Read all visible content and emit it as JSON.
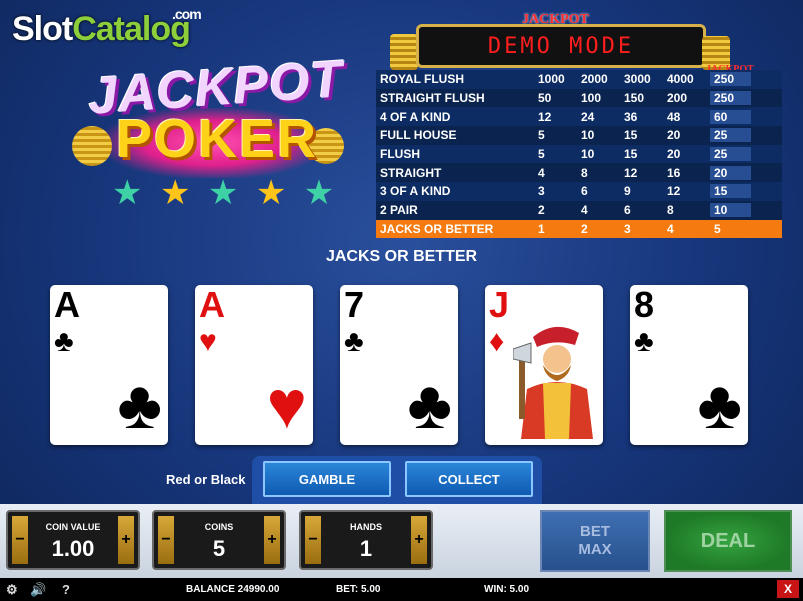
{
  "watermark": {
    "part1": "Slot",
    "part2": "Catalog",
    "part3": ".com"
  },
  "logo": {
    "line1": "JACKPOT",
    "line2": "POKER",
    "stars": [
      "★",
      "★",
      "★",
      "★",
      "★"
    ]
  },
  "paytable": {
    "jackpot_title": "JACKPOT",
    "display": "DEMO MODE",
    "jackpot_column_title": "JACKPOT",
    "rows": [
      {
        "hand": "ROYAL FLUSH",
        "pays": [
          "1000",
          "2000",
          "3000",
          "4000",
          "250"
        ]
      },
      {
        "hand": "STRAIGHT FLUSH",
        "pays": [
          "50",
          "100",
          "150",
          "200",
          "250"
        ]
      },
      {
        "hand": "4 OF A KIND",
        "pays": [
          "12",
          "24",
          "36",
          "48",
          "60"
        ]
      },
      {
        "hand": "FULL HOUSE",
        "pays": [
          "5",
          "10",
          "15",
          "20",
          "25"
        ]
      },
      {
        "hand": "FLUSH",
        "pays": [
          "5",
          "10",
          "15",
          "20",
          "25"
        ]
      },
      {
        "hand": "STRAIGHT",
        "pays": [
          "4",
          "8",
          "12",
          "16",
          "20"
        ]
      },
      {
        "hand": "3 OF A KIND",
        "pays": [
          "3",
          "6",
          "9",
          "12",
          "15"
        ]
      },
      {
        "hand": "2 PAIR",
        "pays": [
          "2",
          "4",
          "6",
          "8",
          "10"
        ]
      },
      {
        "hand": "JACKS OR BETTER",
        "pays": [
          "1",
          "2",
          "3",
          "4",
          "5"
        ]
      }
    ],
    "active_row": 8
  },
  "hand_result": "JACKS OR BETTER",
  "cards": [
    {
      "rank": "A",
      "suit": "♣",
      "color": "black",
      "name": "ace-of-clubs"
    },
    {
      "rank": "A",
      "suit": "♥",
      "color": "red",
      "name": "ace-of-hearts"
    },
    {
      "rank": "7",
      "suit": "♣",
      "color": "black",
      "name": "seven-of-clubs"
    },
    {
      "rank": "J",
      "suit": "♦",
      "color": "red",
      "name": "jack-of-diamonds"
    },
    {
      "rank": "8",
      "suit": "♣",
      "color": "black",
      "name": "eight-of-clubs"
    }
  ],
  "gamble_area": {
    "hint": "Red or Black",
    "gamble_label": "GAMBLE",
    "collect_label": "COLLECT"
  },
  "controls": {
    "coin_value": {
      "label": "COIN VALUE",
      "value": "1.00"
    },
    "coins": {
      "label": "COINS",
      "value": "5"
    },
    "hands": {
      "label": "HANDS",
      "value": "1"
    },
    "minus": "−",
    "plus": "+",
    "bet_max_line1": "BET",
    "bet_max_line2": "MAX",
    "deal_label": "DEAL"
  },
  "status": {
    "balance": "BALANCE 24990.00",
    "bet": "BET: 5.00",
    "win": "WIN: 5.00",
    "help": "?",
    "close": "X",
    "settings_icon": "⚙",
    "sound_icon": "🔊"
  }
}
